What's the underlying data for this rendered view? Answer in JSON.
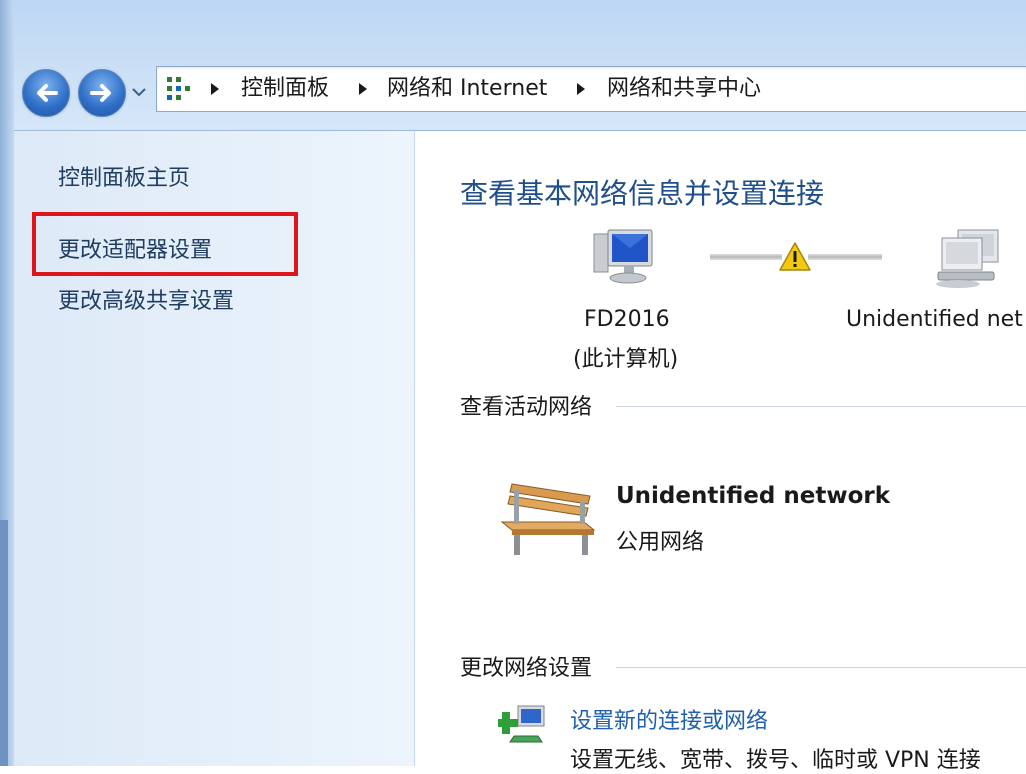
{
  "address_bar": {
    "crumbs": [
      "控制面板",
      "网络和 Internet",
      "网络和共享中心"
    ]
  },
  "nav_pane": {
    "home_link": "控制面板主页",
    "items": [
      {
        "label": "更改适配器设置",
        "highlighted": true
      },
      {
        "label": "更改高级共享设置",
        "highlighted": false
      }
    ]
  },
  "main": {
    "title": "查看基本网络信息并设置连接",
    "network_map": {
      "computer_name": "FD2016",
      "computer_sub": "(此计算机)",
      "network_label": "Unidentified net",
      "status": "warning"
    },
    "active_networks": {
      "heading": "查看活动网络",
      "network_name": "Unidentified network",
      "network_type": "公用网络"
    },
    "change_settings": {
      "heading": "更改网络设置",
      "setup_link": "设置新的连接或网络",
      "setup_desc": "设置无线、宽带、拨号、临时或 VPN 连接"
    }
  },
  "colors": {
    "link": "#1e5fb0",
    "title": "#1e4f8c",
    "highlight_border": "#e0141b",
    "warning": "#f2c811"
  },
  "icons": {
    "back": "back-arrow-icon",
    "forward": "forward-arrow-icon",
    "history": "chevron-down-icon",
    "address": "network-sharing-center-icon",
    "computer": "computer-icon",
    "warning": "warning-icon",
    "network": "network-icon",
    "public_network": "bench-icon",
    "setup": "setup-connection-icon"
  }
}
